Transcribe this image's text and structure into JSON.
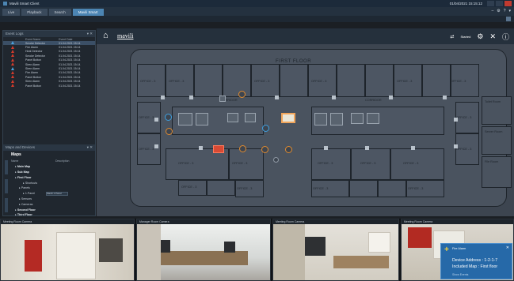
{
  "window": {
    "title": "Mavili Smart Client",
    "clock": "01/04/2021 15:15:12",
    "icons": [
      "minimize-icon",
      "maximize-icon",
      "close-icon"
    ]
  },
  "tabs": [
    {
      "label": "Live",
      "active": false
    },
    {
      "label": "Playback",
      "active": false
    },
    {
      "label": "Search",
      "active": false
    },
    {
      "label": "Mavili Smart",
      "active": true
    }
  ],
  "event_log": {
    "title": "Event Logs",
    "col_name": "Event Name",
    "col_date": "Event Date",
    "rows": [
      {
        "name": "Smoke Detector",
        "date": "01.04.2021 15:14",
        "level": "blue"
      },
      {
        "name": "Fire Alarm",
        "date": "01.04.2021 15:14",
        "level": "red"
      },
      {
        "name": "Heat Detector",
        "date": "01.04.2021 15:14",
        "level": "red"
      },
      {
        "name": "Smoke Detector",
        "date": "01.04.2021 15:14",
        "level": "red"
      },
      {
        "name": "Panel Button",
        "date": "01.04.2021 15:14",
        "level": "red"
      },
      {
        "name": "Siren Alarm",
        "date": "01.04.2021 15:14",
        "level": "red"
      },
      {
        "name": "Siren Alarm",
        "date": "01.04.2021 15:14",
        "level": "blue"
      },
      {
        "name": "Fire Alarm",
        "date": "01.04.2021 15:14",
        "level": "red"
      },
      {
        "name": "Panel Button",
        "date": "01.04.2021 15:14",
        "level": "red"
      },
      {
        "name": "Siren Alarm",
        "date": "01.04.2021 15:14",
        "level": "red"
      },
      {
        "name": "Panel Button",
        "date": "01.04.2021 15:14",
        "level": "red"
      }
    ]
  },
  "maps_panel": {
    "title": "Maps and Devices",
    "heading": "Maps",
    "col_name": "Name",
    "col_desc": "Description",
    "tree": [
      {
        "label": "Main Map",
        "bold": true,
        "indent": 1
      },
      {
        "label": "Sub Map",
        "bold": true,
        "indent": 1
      },
      {
        "label": "First Floor",
        "bold": true,
        "indent": 1
      },
      {
        "label": "Shortcuts",
        "bold": false,
        "indent": 3
      },
      {
        "label": "Panels",
        "bold": false,
        "indent": 2
      },
      {
        "label": "1.Panel",
        "bold": false,
        "indent": 3,
        "desc": "Mavili 1 Panel"
      },
      {
        "label": "Sensors",
        "bold": false,
        "indent": 2
      },
      {
        "label": "Cameras",
        "bold": false,
        "indent": 2
      },
      {
        "label": "Second Floor",
        "bold": true,
        "indent": 1
      },
      {
        "label": "Third Floor",
        "bold": true,
        "indent": 1
      }
    ]
  },
  "map": {
    "brand": "mavili",
    "user_label": "Started",
    "floor_title": "FIRST FLOOR",
    "corridor_label": "CORRIDOR",
    "office_label": "OFFICE - 3",
    "side_rooms": [
      "Toilet Room",
      "Server Room",
      "File Room"
    ]
  },
  "cameras": [
    {
      "label": "Meeting Room Camera"
    },
    {
      "label": "Manager Room Camera"
    },
    {
      "label": "Meeting Room Camera"
    },
    {
      "label": "Meeting Room Camera"
    }
  ],
  "notification": {
    "title": "Fire Alarm",
    "device_address": "Device Address : 1-2-1-7",
    "included_map": "Included Map : First floor",
    "footer": "Show Events"
  }
}
